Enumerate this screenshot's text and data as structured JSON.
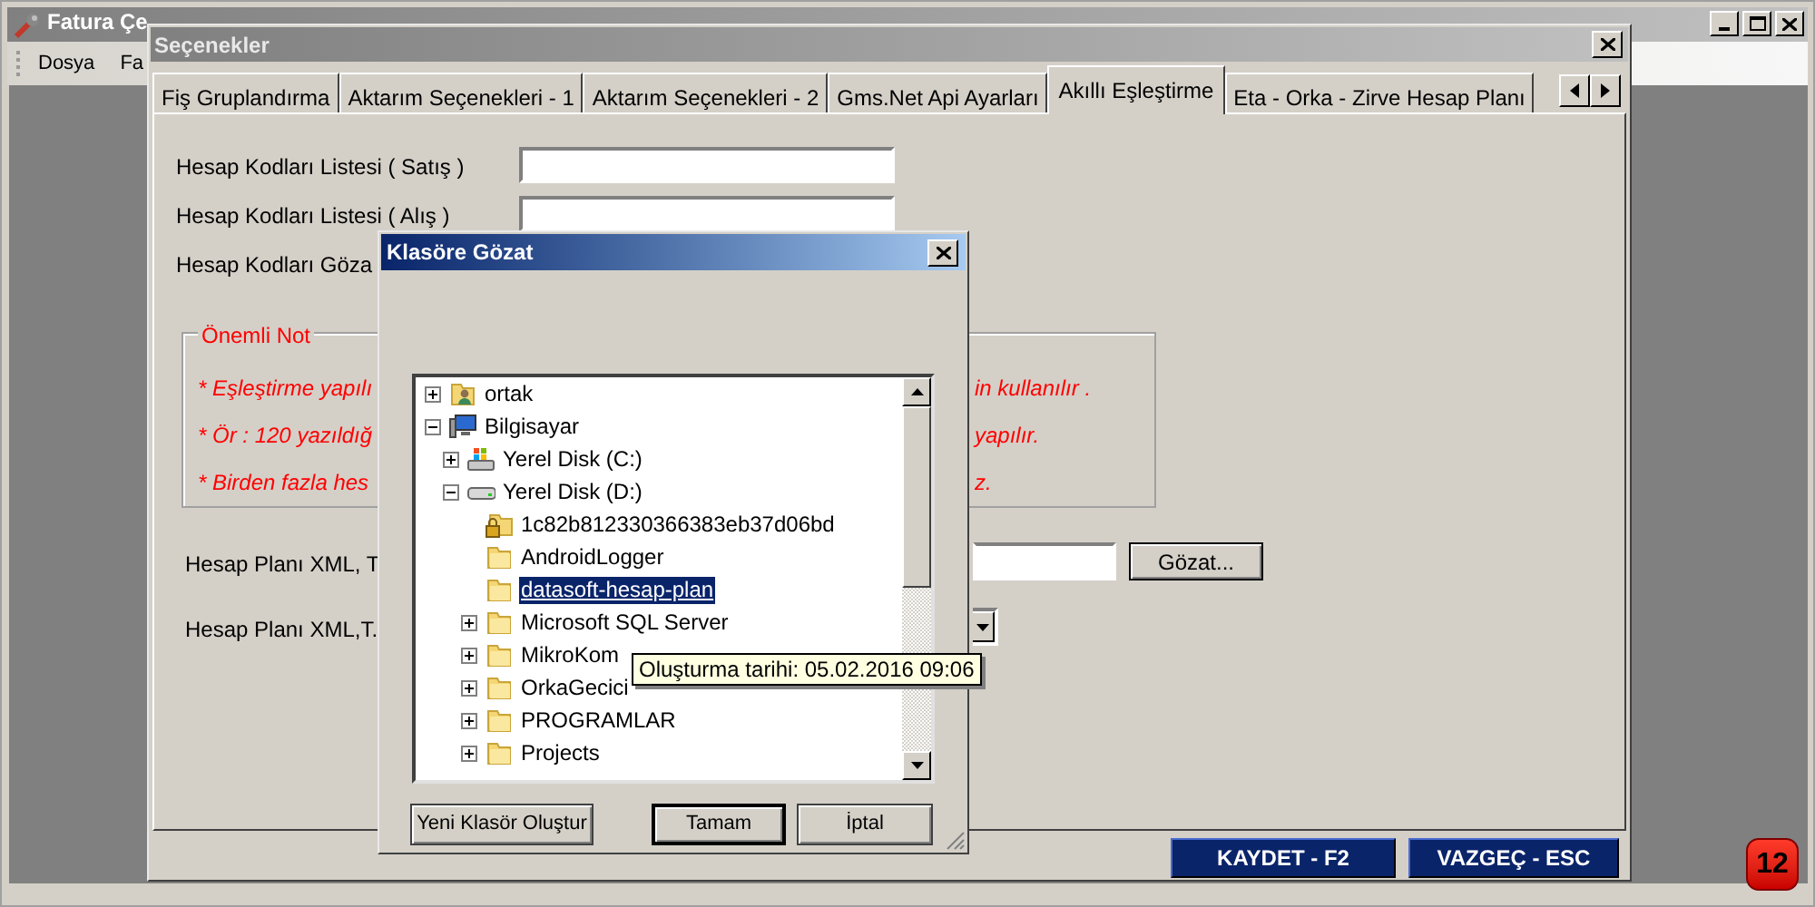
{
  "main_window": {
    "title": "Fatura Çe",
    "menu": [
      "Dosya",
      "Fa"
    ]
  },
  "options_dialog": {
    "title": "Seçenekler",
    "tabs": [
      {
        "label": "Fiş Gruplandırma",
        "selected": false
      },
      {
        "label": "Aktarım Seçenekleri - 1",
        "selected": false
      },
      {
        "label": "Aktarım Seçenekleri - 2",
        "selected": false
      },
      {
        "label": "Gms.Net Api Ayarları",
        "selected": false
      },
      {
        "label": "Akıllı Eşleştirme",
        "selected": true
      },
      {
        "label": "Eta - Orka - Zirve Hesap Planı",
        "selected": false
      }
    ],
    "fields": [
      {
        "label": "Hesap Kodları Listesi ( Satış )",
        "kind": "text"
      },
      {
        "label": "Hesap Kodları Listesi ( Alış )",
        "kind": "text"
      },
      {
        "label": "Hesap Kodları Göza",
        "kind": "label"
      }
    ],
    "note": {
      "title": "Önemli Not",
      "lines": [
        {
          "left": "* Eşleştirme yapılı",
          "right": "in kullanılır ."
        },
        {
          "left": "* Ör : 120 yazıldığ",
          "right": "yapılır."
        },
        {
          "left": "* Birden fazla hes",
          "right": "z."
        }
      ]
    },
    "xml_rows": [
      {
        "label": "Hesap Planı XML, T",
        "kind": "file"
      },
      {
        "label": "Hesap Planı XML,T.",
        "kind": "combo"
      }
    ],
    "browse_button": "Gözat...",
    "buttons": [
      "KAYDET - F2",
      "VAZGEÇ - ESC"
    ]
  },
  "badge": "12",
  "browse_dialog": {
    "title": "Klasöre Gözat",
    "tree": [
      {
        "label": "ortak",
        "kind": "shared",
        "expanded": false,
        "selected": false
      },
      {
        "label": "Bilgisayar",
        "kind": "computer",
        "expanded": true,
        "selected": false,
        "children": [
          {
            "label": "Yerel Disk (C:)",
            "kind": "system",
            "expanded": false,
            "selected": false
          },
          {
            "label": "Yerel Disk (D:)",
            "kind": "disk",
            "expanded": true,
            "selected": false,
            "children": [
              {
                "label": "1c82b812330366383eb37d06bd",
                "kind": "locked",
                "selected": false
              },
              {
                "label": "AndroidLogger",
                "kind": "folder",
                "selected": false
              },
              {
                "label": "datasoft-hesap-plan",
                "kind": "folder",
                "selected": true
              },
              {
                "label": "Microsoft SQL Server",
                "kind": "folder",
                "expanded": false,
                "selected": false
              },
              {
                "label": "MikroKom",
                "kind": "folder",
                "expanded": false,
                "selected": false
              },
              {
                "label": "OrkaGecici",
                "kind": "folder",
                "expanded": false,
                "selected": false
              },
              {
                "label": "PROGRAMLAR",
                "kind": "folder",
                "expanded": false,
                "selected": false
              },
              {
                "label": "Projects",
                "kind": "folder",
                "expanded": false,
                "selected": false
              }
            ]
          }
        ]
      }
    ],
    "tooltip": "Oluşturma tarihi: 05.02.2016 09:06",
    "buttons": [
      "Yeni Klasör Oluştur",
      "Tamam",
      "İptal"
    ]
  }
}
